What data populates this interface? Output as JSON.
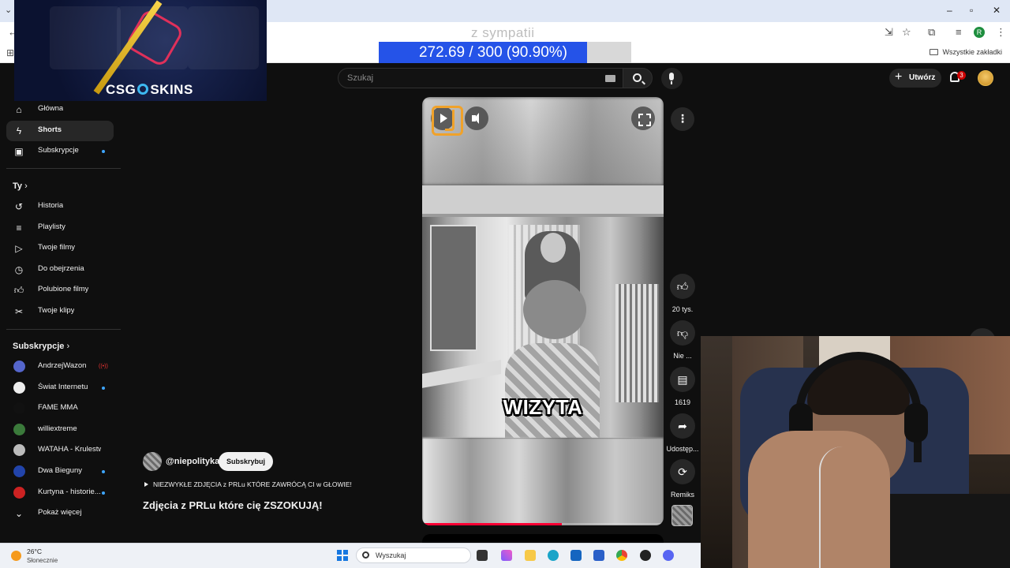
{
  "browser": {
    "bookmarks_all": "Wszystkie zakładki",
    "profile_initial": "R"
  },
  "overlays": {
    "csgo_logo_left": "CSG",
    "csgo_logo_right": "SKINS",
    "goal_label": "z sympatii",
    "goal_text": "272.69 / 300 (90.90%)",
    "goal_fraction": 0.909
  },
  "topbar": {
    "search_placeholder": "Szukaj",
    "create_label": "Utwórz",
    "notifications_count": "3"
  },
  "sidebar": {
    "main": [
      {
        "label": "Główna",
        "icon": "home-icon"
      },
      {
        "label": "Shorts",
        "icon": "shorts-icon",
        "active": true
      },
      {
        "label": "Subskrypcje",
        "icon": "subscriptions-icon",
        "dot": true
      }
    ],
    "you_title": "Ty",
    "you": [
      {
        "label": "Historia",
        "icon": "history-icon"
      },
      {
        "label": "Playlisty",
        "icon": "playlists-icon"
      },
      {
        "label": "Twoje filmy",
        "icon": "your-videos-icon"
      },
      {
        "label": "Do obejrzenia",
        "icon": "watch-later-icon"
      },
      {
        "label": "Polubione filmy",
        "icon": "liked-icon"
      },
      {
        "label": "Twoje klipy",
        "icon": "clips-icon"
      }
    ],
    "subs_title": "Subskrypcje",
    "subs": [
      {
        "label": "AndrzejWazon",
        "live": true,
        "color": "#5566cc"
      },
      {
        "label": "Świat Internetu",
        "dot": true,
        "color": "#eeeeee"
      },
      {
        "label": "FAME MMA",
        "color": "#111111"
      },
      {
        "label": "williextreme",
        "color": "#3b7a3b"
      },
      {
        "label": "WATAHA - Krulestwo",
        "color": "#bbbbbb"
      },
      {
        "label": "Dwa Bieguny",
        "dot": true,
        "color": "#2244aa"
      },
      {
        "label": "Kurtyna - historie...",
        "dot": true,
        "color": "#cc2222"
      }
    ],
    "show_more": "Pokaż więcej"
  },
  "short": {
    "caption": "WIZYTA",
    "progress": 0.58,
    "channel": "@niepolityka",
    "subscribe_label": "Subskrybuj",
    "description": "NIEZWYKŁE ZDJĘCIA z PRLu KTÓRE ZAWRÓCĄ CI w GŁOWIE!",
    "title": "Zdjęcia z PRLu które cię ZSZOKUJĄ!"
  },
  "actions": {
    "likes": "20 tys.",
    "dislike": "Nie ...",
    "comments": "1619",
    "share": "Udostęp...",
    "remix": "Remiks"
  },
  "taskbar": {
    "temperature": "26°C",
    "condition": "Słonecznie",
    "search_placeholder": "Wyszukaj"
  }
}
